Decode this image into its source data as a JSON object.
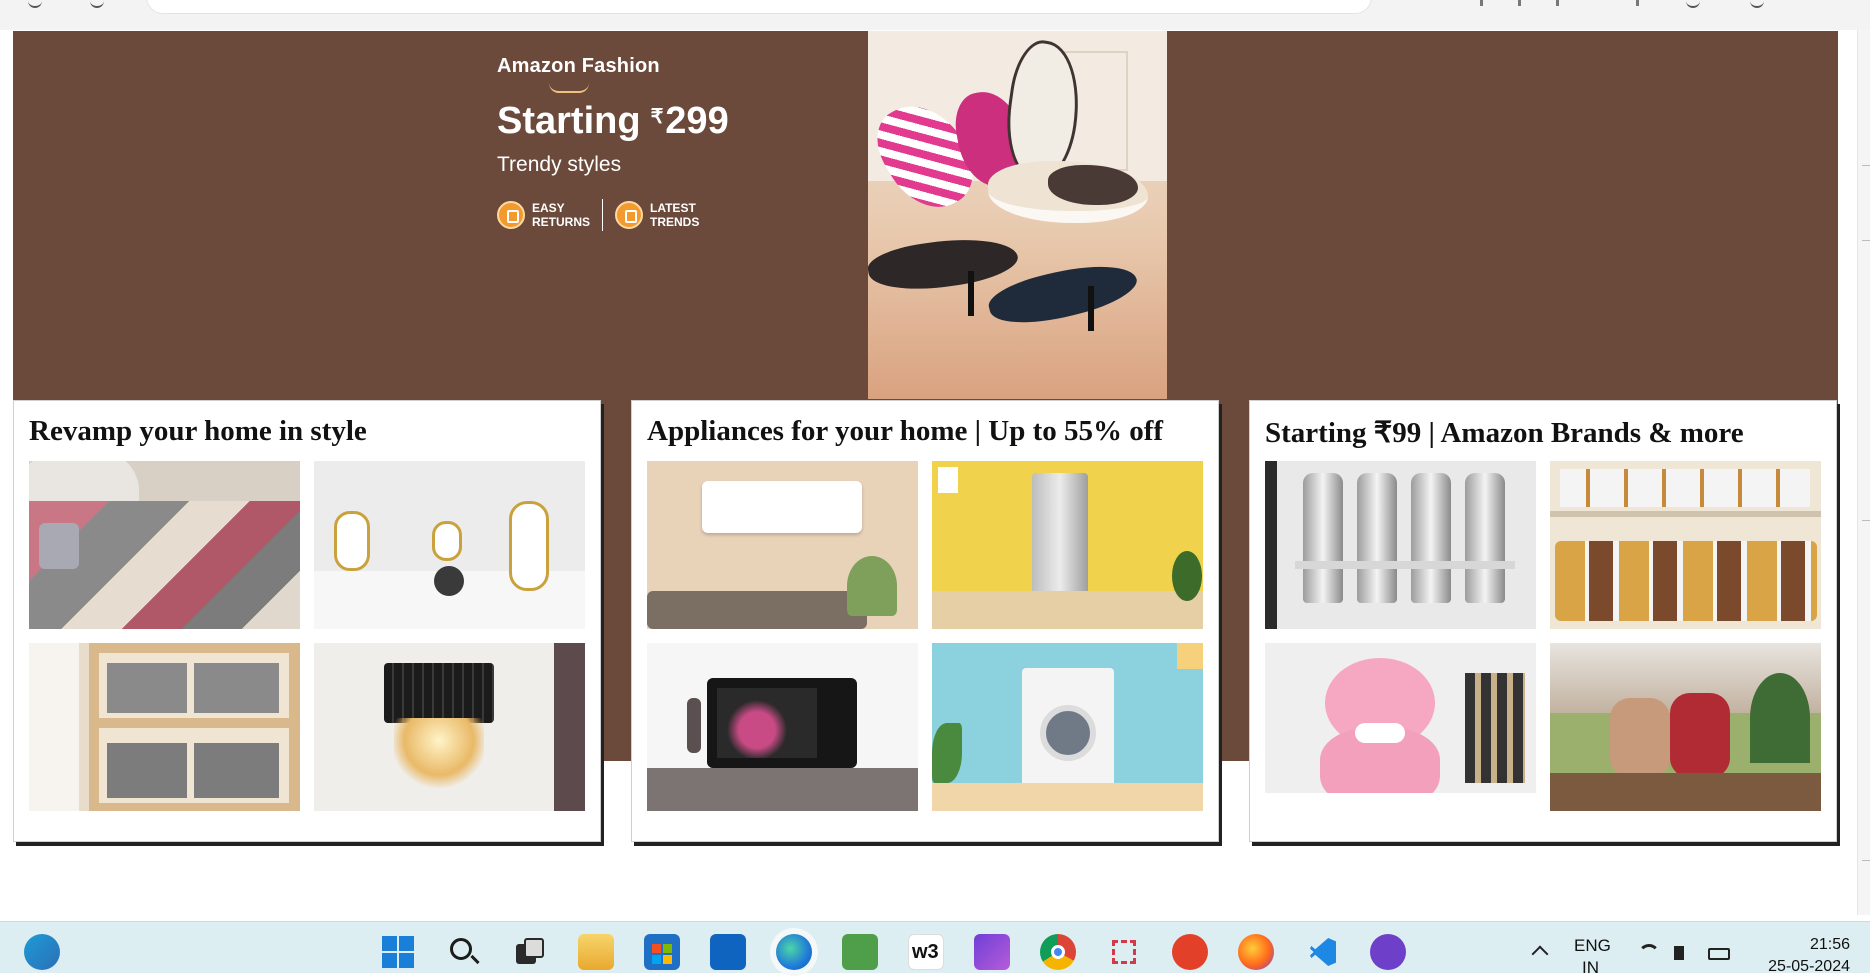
{
  "hero": {
    "brand": "Amazon Fashion",
    "headline_prefix": "Starting",
    "currency": "₹",
    "price": "299",
    "subline": "Trendy styles",
    "badges": [
      {
        "line1": "EASY",
        "line2": "RETURNS"
      },
      {
        "line1": "LATEST",
        "line2": "TRENDS"
      }
    ],
    "colors": {
      "background": "#6b4a3c",
      "badge": "#f29a2e"
    }
  },
  "cards": [
    {
      "title": "Revamp your home in style",
      "tiles": [
        "rug",
        "astronaut-figurines",
        "storage-boxes",
        "wall-lamp"
      ]
    },
    {
      "title": "Appliances for your home | Up to 55% off",
      "tiles": [
        "air-conditioner",
        "refrigerator",
        "microwave",
        "washing-machine"
      ]
    },
    {
      "title": "Starting ₹99 | Amazon Brands & more",
      "tiles": [
        "steel-bottles",
        "storage-jars",
        "teddy-bear",
        "winter-jackets"
      ]
    }
  ],
  "taskbar": {
    "icons": [
      "start-icon",
      "search-icon",
      "task-view-icon",
      "file-explorer-icon",
      "store-icon",
      "outlook-icon",
      "edge-icon",
      "notepad-icon",
      "w3-icon",
      "clipchamp-icon",
      "chrome-icon",
      "snipping-icon",
      "git-icon",
      "firefox-icon",
      "vscode-icon",
      "github-icon"
    ],
    "w3_label": "w3",
    "language": "ENG",
    "region": "IN",
    "time": "21:56",
    "date": "25-05-2024"
  }
}
